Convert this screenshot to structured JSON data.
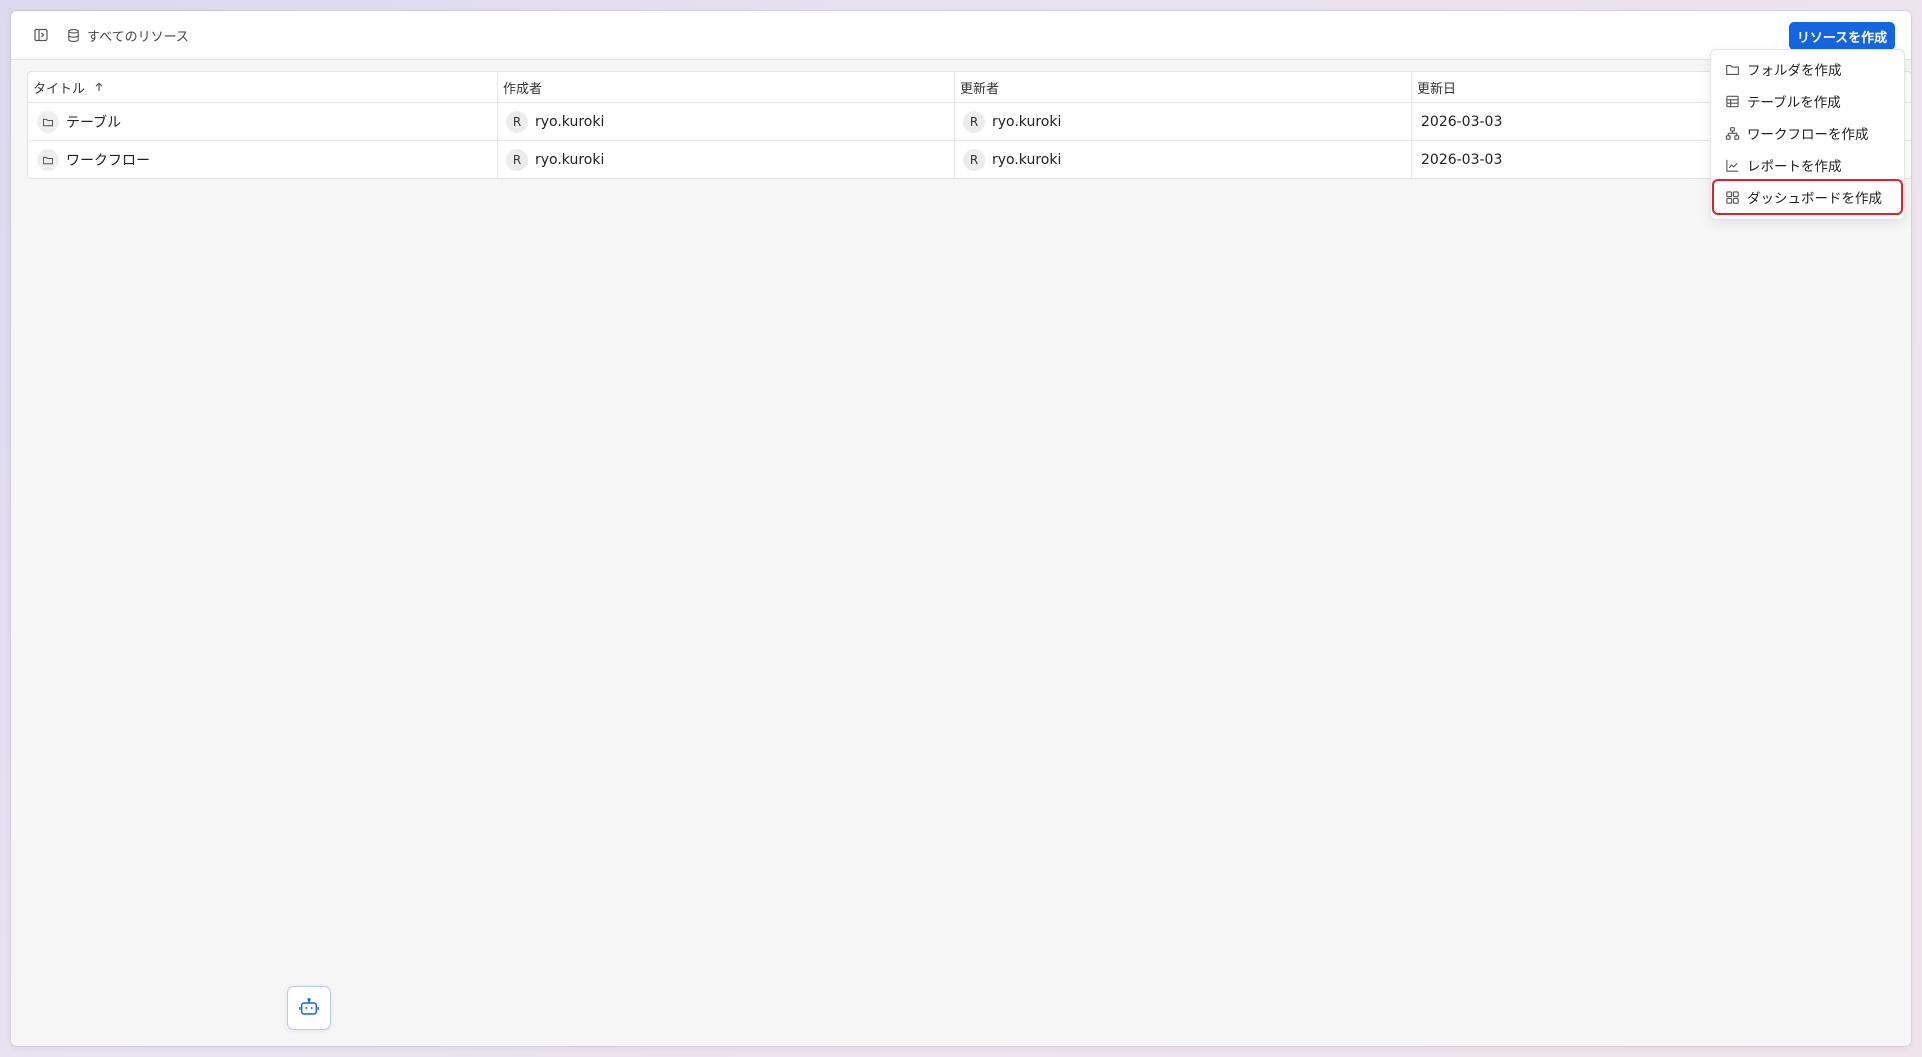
{
  "header": {
    "breadcrumb_label": "すべてのリソース",
    "create_button_label": "リソースを作成"
  },
  "table": {
    "columns": [
      "タイトル",
      "作成者",
      "更新者",
      "更新日"
    ],
    "rows": [
      {
        "title": "テーブル",
        "creator_initial": "R",
        "creator": "ryo.kuroki",
        "updater_initial": "R",
        "updater": "ryo.kuroki",
        "updated": "2026-03-03"
      },
      {
        "title": "ワークフロー",
        "creator_initial": "R",
        "creator": "ryo.kuroki",
        "updater_initial": "R",
        "updater": "ryo.kuroki",
        "updated": "2026-03-03"
      }
    ]
  },
  "menu": {
    "items": [
      {
        "label": "フォルダを作成",
        "icon": "folder-icon"
      },
      {
        "label": "テーブルを作成",
        "icon": "table-icon"
      },
      {
        "label": "ワークフローを作成",
        "icon": "workflow-icon"
      },
      {
        "label": "レポートを作成",
        "icon": "chart-icon"
      },
      {
        "label": "ダッシュボードを作成",
        "icon": "dashboard-icon"
      }
    ]
  },
  "colors": {
    "accent": "#1565e0",
    "highlight": "#e0202e"
  }
}
